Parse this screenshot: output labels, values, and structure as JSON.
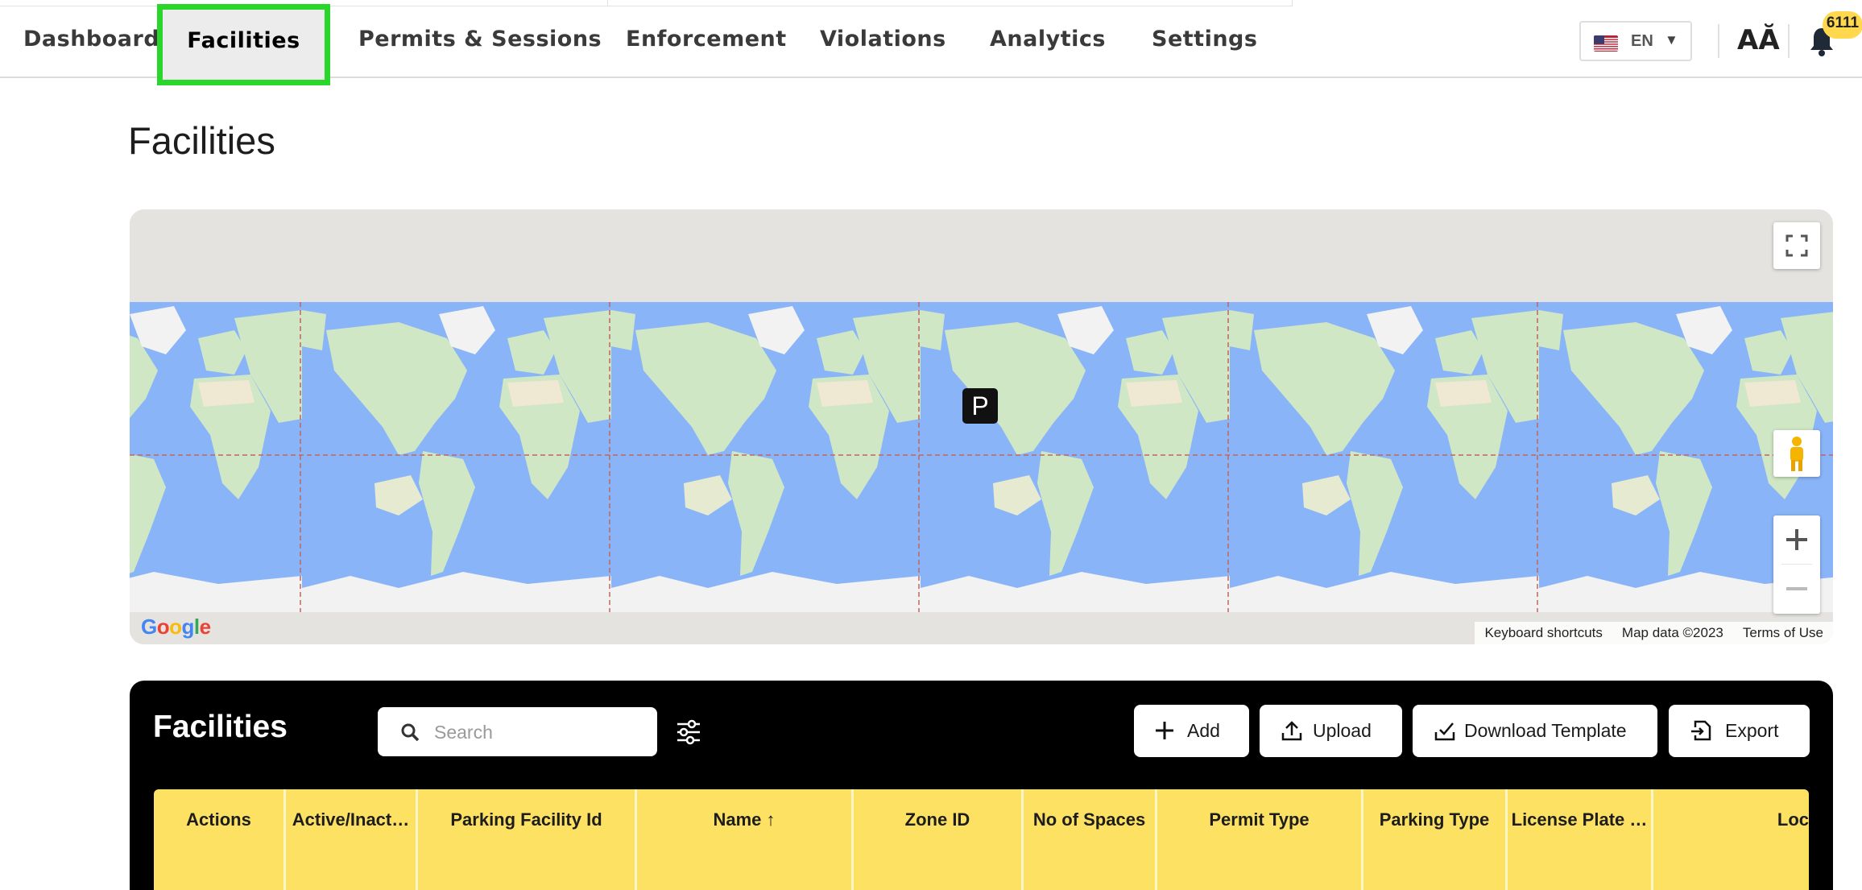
{
  "nav": {
    "items": [
      {
        "label": "Dashboard"
      },
      {
        "label": "Facilities"
      },
      {
        "label": "Permits & Sessions"
      },
      {
        "label": "Enforcement"
      },
      {
        "label": "Violations"
      },
      {
        "label": "Analytics"
      },
      {
        "label": "Settings"
      }
    ],
    "active": "Facilities",
    "language": "EN",
    "font_size_icon": "font-size-icon",
    "notifications_count": "6111"
  },
  "page": {
    "title": "Facilities"
  },
  "map": {
    "marker_label": "P",
    "google_logo": "Google",
    "footer": {
      "shortcuts": "Keyboard shortcuts",
      "data": "Map data ©2023",
      "terms": "Terms of Use"
    },
    "colors": {
      "ocean": "#8ab4f8",
      "land": "#cfe7c4",
      "ice": "#f2f2f2",
      "background": "#e5e3df"
    }
  },
  "panel": {
    "title": "Facilities",
    "search_placeholder": "Search",
    "buttons": {
      "add": "Add",
      "upload": "Upload",
      "download_template": "Download Template",
      "export": "Export"
    },
    "columns": [
      "Actions",
      "Active/Inact…",
      "Parking Facility Id",
      "Name ↑",
      "Zone ID",
      "No of Spaces",
      "Permit Type",
      "Parking Type",
      "License Plate …",
      "Loc"
    ],
    "header_color": "#fde163"
  }
}
